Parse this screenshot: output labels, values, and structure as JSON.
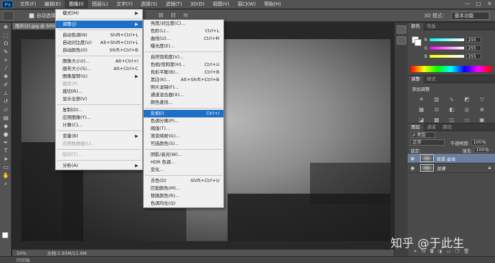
{
  "app": {
    "logo_text": "Ps"
  },
  "menubar": {
    "items": [
      "文件(F)",
      "编辑(E)",
      "图像(I)",
      "图层(L)",
      "文字(Y)",
      "选择(S)",
      "滤镜(T)",
      "3D(D)",
      "视图(V)",
      "窗口(W)",
      "帮助(H)"
    ],
    "active_index": 2,
    "window_controls": [
      "—",
      "□",
      "✕"
    ]
  },
  "options_bar": {
    "auto_select_label": "自动选择：",
    "mode_3d_label": "3D 模式：",
    "workspace_label": "基本功能"
  },
  "document": {
    "tab_label": "雨炎(2).jpg @ 50%",
    "zoom": "50%",
    "doc_info": "文档:1.93M/11.9M"
  },
  "timeline_label": "时间轴",
  "image_menu": {
    "items": [
      {
        "label": "模式(M)",
        "shortcut": "",
        "submenu": true,
        "disabled": false
      },
      {
        "sep": true
      },
      {
        "label": "调整(J)",
        "shortcut": "",
        "submenu": true,
        "disabled": false,
        "highlighted": true
      },
      {
        "sep": true
      },
      {
        "label": "自动色调(N)",
        "shortcut": "Shift+Ctrl+L",
        "disabled": false
      },
      {
        "label": "自动对比度(U)",
        "shortcut": "Alt+Shift+Ctrl+L",
        "disabled": false
      },
      {
        "label": "自动颜色(O)",
        "shortcut": "Shift+Ctrl+B",
        "disabled": false
      },
      {
        "sep": true
      },
      {
        "label": "图像大小(I)...",
        "shortcut": "Alt+Ctrl+I",
        "disabled": false
      },
      {
        "label": "画布大小(S)...",
        "shortcut": "Alt+Ctrl+C",
        "disabled": false
      },
      {
        "label": "图像旋转(G)",
        "shortcut": "",
        "submenu": true,
        "disabled": false
      },
      {
        "label": "裁剪(P)",
        "shortcut": "",
        "disabled": true
      },
      {
        "label": "裁切(R)...",
        "shortcut": "",
        "disabled": false
      },
      {
        "label": "显示全部(V)",
        "shortcut": "",
        "disabled": false
      },
      {
        "sep": true
      },
      {
        "label": "复制(D)...",
        "shortcut": "",
        "disabled": false
      },
      {
        "label": "应用图像(Y)...",
        "shortcut": "",
        "disabled": false
      },
      {
        "label": "计算(C)...",
        "shortcut": "",
        "disabled": false
      },
      {
        "sep": true
      },
      {
        "label": "变量(B)",
        "shortcut": "",
        "submenu": true,
        "disabled": false
      },
      {
        "label": "应用数据组(L)...",
        "shortcut": "",
        "disabled": true
      },
      {
        "sep": true
      },
      {
        "label": "陷印(T)...",
        "shortcut": "",
        "disabled": true
      },
      {
        "sep": true
      },
      {
        "label": "分析(A)",
        "shortcut": "",
        "submenu": true,
        "disabled": false
      }
    ]
  },
  "adjust_menu": {
    "items": [
      {
        "label": "亮度/对比度(C)...",
        "shortcut": ""
      },
      {
        "label": "色阶(L)...",
        "shortcut": "Ctrl+L"
      },
      {
        "label": "曲线(U)...",
        "shortcut": "Ctrl+M"
      },
      {
        "label": "曝光度(E)...",
        "shortcut": ""
      },
      {
        "sep": true
      },
      {
        "label": "自然饱和度(V)...",
        "shortcut": ""
      },
      {
        "label": "色相/饱和度(H)...",
        "shortcut": "Ctrl+U"
      },
      {
        "label": "色彩平衡(B)...",
        "shortcut": "Ctrl+B"
      },
      {
        "label": "黑白(K)...",
        "shortcut": "Alt+Shift+Ctrl+B"
      },
      {
        "label": "照片滤镜(F)...",
        "shortcut": ""
      },
      {
        "label": "通道混合器(X)...",
        "shortcut": ""
      },
      {
        "label": "颜色查找...",
        "shortcut": ""
      },
      {
        "sep": true
      },
      {
        "label": "反相(I)",
        "shortcut": "Ctrl+I",
        "highlighted": true
      },
      {
        "label": "色调分离(P)...",
        "shortcut": ""
      },
      {
        "label": "阈值(T)...",
        "shortcut": ""
      },
      {
        "label": "渐变映射(G)...",
        "shortcut": ""
      },
      {
        "label": "可选颜色(S)...",
        "shortcut": ""
      },
      {
        "sep": true
      },
      {
        "label": "阴影/高光(W)...",
        "shortcut": ""
      },
      {
        "label": "HDR 色调...",
        "shortcut": ""
      },
      {
        "label": "变化...",
        "shortcut": ""
      },
      {
        "sep": true
      },
      {
        "label": "去色(D)",
        "shortcut": "Shift+Ctrl+U"
      },
      {
        "label": "匹配颜色(M)...",
        "shortcut": ""
      },
      {
        "label": "替换颜色(R)...",
        "shortcut": ""
      },
      {
        "label": "色调均化(Q)",
        "shortcut": ""
      }
    ]
  },
  "color_panel": {
    "tabs": [
      "颜色",
      "色板"
    ],
    "rows": [
      {
        "label": "R",
        "value": "255"
      },
      {
        "label": "G",
        "value": "255"
      },
      {
        "label": "B",
        "value": "255"
      }
    ]
  },
  "adjust_panel": {
    "tabs": [
      "调整",
      "样式"
    ],
    "title": "添加调整"
  },
  "layers_panel": {
    "tabs": [
      "图层",
      "通道",
      "路径"
    ],
    "kind_label": "ρ 类型",
    "blend_mode": "正常",
    "opacity_label": "不透明度:",
    "opacity_value": "100%",
    "lock_label": "锁定:",
    "fill_label": "填充:",
    "fill_value": "100%",
    "layers": [
      {
        "name": "背景 副本",
        "selected": true
      },
      {
        "name": "背景",
        "selected": false,
        "locked": true
      }
    ]
  },
  "watermark": "知乎 @于此生",
  "colors": {
    "menu_highlight": "#1e6fc6",
    "ui_dark": "#535353",
    "layer_selected": "#6a7ea0"
  }
}
